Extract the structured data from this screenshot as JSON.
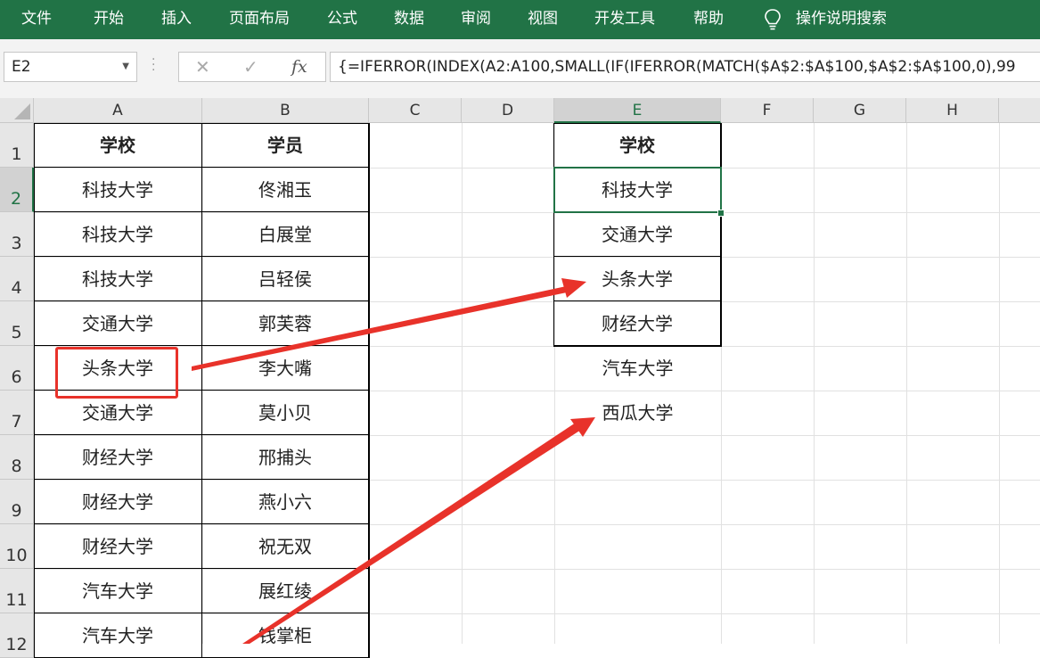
{
  "ribbon": {
    "tabs": [
      "文件",
      "开始",
      "插入",
      "页面布局",
      "公式",
      "数据",
      "审阅",
      "视图",
      "开发工具",
      "帮助"
    ],
    "search_label": "操作说明搜索",
    "icon": "lightbulb-icon"
  },
  "formula_bar": {
    "name_box": "E2",
    "cancel_icon": "✕",
    "enter_icon": "✓",
    "fx_label": "fx",
    "formula": "{=IFERROR(INDEX(A2:A100,SMALL(IF(IFERROR(MATCH($A$2:$A$100,$A$2:$A$100,0),99"
  },
  "columns": [
    "A",
    "B",
    "C",
    "D",
    "E",
    "F",
    "G",
    "H"
  ],
  "rows": [
    "1",
    "2",
    "3",
    "4",
    "5",
    "6",
    "7",
    "8",
    "9",
    "10",
    "11",
    "12"
  ],
  "cells": {
    "A": [
      "学校",
      "科技大学",
      "科技大学",
      "科技大学",
      "交通大学",
      "头条大学",
      "交通大学",
      "财经大学",
      "财经大学",
      "财经大学",
      "汽车大学",
      "汽车大学"
    ],
    "B": [
      "学员",
      "佟湘玉",
      "白展堂",
      "吕轻侯",
      "郭芙蓉",
      "李大嘴",
      "莫小贝",
      "邢捕头",
      "燕小六",
      "祝无双",
      "展红绫",
      "钱掌柜"
    ],
    "E": [
      "学校",
      "科技大学",
      "交通大学",
      "头条大学",
      "财经大学",
      "汽车大学",
      "西瓜大学"
    ]
  },
  "selected_cell": "E2",
  "colors": {
    "ribbon": "#217346",
    "annotation": "#e8322a",
    "selection": "#217346"
  }
}
